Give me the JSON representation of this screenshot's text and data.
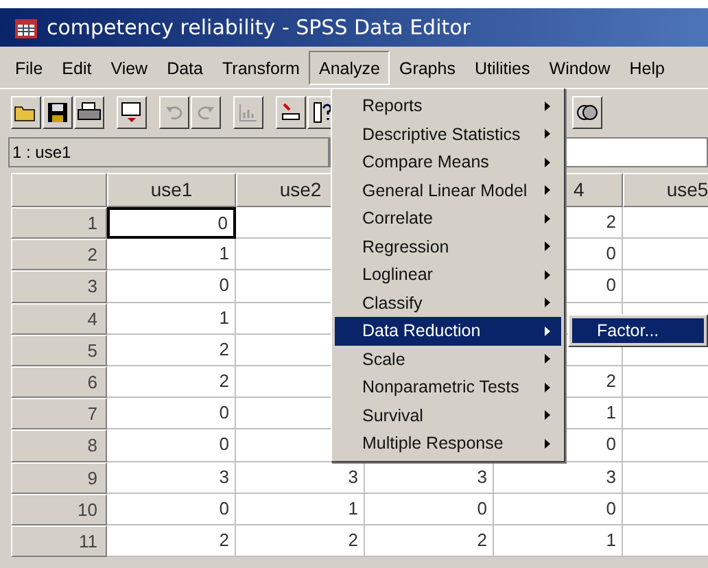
{
  "window": {
    "title": "competency reliability - SPSS Data Editor"
  },
  "menubar": [
    {
      "label": "File",
      "selected": false
    },
    {
      "label": "Edit",
      "selected": false
    },
    {
      "label": "View",
      "selected": false
    },
    {
      "label": "Data",
      "selected": false
    },
    {
      "label": "Transform",
      "selected": false
    },
    {
      "label": "Analyze",
      "selected": true
    },
    {
      "label": "Graphs",
      "selected": false
    },
    {
      "label": "Utilities",
      "selected": false
    },
    {
      "label": "Window",
      "selected": false
    },
    {
      "label": "Help",
      "selected": false
    }
  ],
  "cell_reference": "1 : use1",
  "table": {
    "columns": [
      "use1",
      "use2",
      null,
      "4",
      "use5"
    ],
    "rows": [
      {
        "label": "1",
        "current": true,
        "cells": [
          "0",
          null,
          null,
          "2",
          null
        ]
      },
      {
        "label": "2",
        "current": false,
        "cells": [
          "1",
          null,
          null,
          "0",
          null
        ]
      },
      {
        "label": "3",
        "current": false,
        "cells": [
          "0",
          null,
          null,
          "0",
          null
        ]
      },
      {
        "label": "4",
        "current": false,
        "cells": [
          "1",
          null,
          null,
          null,
          null
        ]
      },
      {
        "label": "5",
        "current": false,
        "cells": [
          "2",
          null,
          null,
          null,
          null
        ]
      },
      {
        "label": "6",
        "current": false,
        "cells": [
          "2",
          null,
          null,
          "2",
          null
        ]
      },
      {
        "label": "7",
        "current": false,
        "cells": [
          "0",
          null,
          null,
          "1",
          null
        ]
      },
      {
        "label": "8",
        "current": false,
        "cells": [
          "0",
          null,
          null,
          "0",
          null
        ]
      },
      {
        "label": "9",
        "current": false,
        "cells": [
          "3",
          "3",
          "3",
          "3",
          null
        ]
      },
      {
        "label": "10",
        "current": false,
        "cells": [
          "0",
          "1",
          "0",
          "0",
          null
        ]
      },
      {
        "label": "11",
        "current": false,
        "cells": [
          "2",
          "2",
          "2",
          "1",
          null
        ]
      }
    ]
  },
  "analyze_menu": [
    {
      "label": "Reports",
      "submenu": true,
      "selected": false
    },
    {
      "label": "Descriptive Statistics",
      "submenu": true,
      "selected": false
    },
    {
      "label": "Compare Means",
      "submenu": true,
      "selected": false
    },
    {
      "label": "General Linear Model",
      "submenu": true,
      "selected": false
    },
    {
      "label": "Correlate",
      "submenu": true,
      "selected": false
    },
    {
      "label": "Regression",
      "submenu": true,
      "selected": false
    },
    {
      "label": "Loglinear",
      "submenu": true,
      "selected": false
    },
    {
      "label": "Classify",
      "submenu": true,
      "selected": false
    },
    {
      "label": "Data Reduction",
      "submenu": true,
      "selected": true
    },
    {
      "label": "Scale",
      "submenu": true,
      "selected": false
    },
    {
      "label": "Nonparametric Tests",
      "submenu": true,
      "selected": false
    },
    {
      "label": "Survival",
      "submenu": true,
      "selected": false
    },
    {
      "label": "Multiple Response",
      "submenu": true,
      "selected": false
    }
  ],
  "submenu": [
    {
      "label": "Factor...",
      "selected": true
    }
  ]
}
